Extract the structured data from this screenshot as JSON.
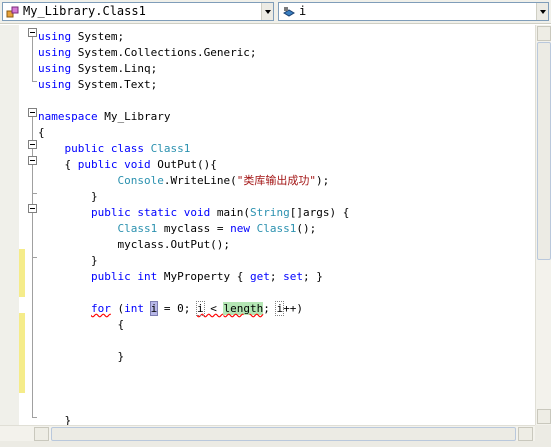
{
  "navbar": {
    "type_combo_value": "My_Library.Class1",
    "member_combo_value": "i"
  },
  "editor": {
    "lines": [
      {
        "parts": [
          {
            "t": "using",
            "c": "kw"
          },
          {
            "t": " System;"
          }
        ]
      },
      {
        "parts": [
          {
            "t": "using",
            "c": "kw"
          },
          {
            "t": " System.Collections.Generic;"
          }
        ]
      },
      {
        "parts": [
          {
            "t": "using",
            "c": "kw"
          },
          {
            "t": " System.Linq;"
          }
        ]
      },
      {
        "parts": [
          {
            "t": "using",
            "c": "kw"
          },
          {
            "t": " System.Text;"
          }
        ]
      },
      {
        "parts": []
      },
      {
        "parts": [
          {
            "t": "namespace",
            "c": "kw"
          },
          {
            "t": " My_Library"
          }
        ]
      },
      {
        "parts": [
          {
            "t": "{"
          }
        ]
      },
      {
        "parts": [
          {
            "t": "    "
          },
          {
            "t": "public",
            "c": "kw"
          },
          {
            "t": " "
          },
          {
            "t": "class",
            "c": "kw"
          },
          {
            "t": " "
          },
          {
            "t": "Class1",
            "c": "ty"
          }
        ]
      },
      {
        "parts": [
          {
            "t": "    { "
          },
          {
            "t": "public",
            "c": "kw"
          },
          {
            "t": " "
          },
          {
            "t": "void",
            "c": "kw"
          },
          {
            "t": " OutPut(){"
          }
        ]
      },
      {
        "parts": [
          {
            "t": "            "
          },
          {
            "t": "Console",
            "c": "ty"
          },
          {
            "t": ".WriteLine("
          },
          {
            "t": "\"类库输出成功\"",
            "c": "st"
          },
          {
            "t": ");"
          }
        ]
      },
      {
        "parts": [
          {
            "t": "        }"
          }
        ]
      },
      {
        "parts": [
          {
            "t": "        "
          },
          {
            "t": "public",
            "c": "kw"
          },
          {
            "t": " "
          },
          {
            "t": "static",
            "c": "kw"
          },
          {
            "t": " "
          },
          {
            "t": "void",
            "c": "kw"
          },
          {
            "t": " main("
          },
          {
            "t": "String",
            "c": "ty"
          },
          {
            "t": "[]args) {"
          }
        ]
      },
      {
        "parts": [
          {
            "t": "            "
          },
          {
            "t": "Class1",
            "c": "ty"
          },
          {
            "t": " myclass = "
          },
          {
            "t": "new",
            "c": "kw"
          },
          {
            "t": " "
          },
          {
            "t": "Class1",
            "c": "ty"
          },
          {
            "t": "();"
          }
        ]
      },
      {
        "parts": [
          {
            "t": "            myclass.OutPut();"
          }
        ]
      },
      {
        "parts": [
          {
            "t": "        }"
          }
        ]
      },
      {
        "parts": [
          {
            "t": "        "
          },
          {
            "t": "public",
            "c": "kw"
          },
          {
            "t": " "
          },
          {
            "t": "int",
            "c": "kw"
          },
          {
            "t": " MyProperty { "
          },
          {
            "t": "get",
            "c": "kw"
          },
          {
            "t": "; "
          },
          {
            "t": "set",
            "c": "kw"
          },
          {
            "t": "; }"
          }
        ]
      },
      {
        "parts": []
      },
      {
        "parts": [
          {
            "t": "        "
          },
          {
            "t": "for",
            "c": "kw err"
          },
          {
            "t": " ("
          },
          {
            "t": "int",
            "c": "kw"
          },
          {
            "t": " "
          },
          {
            "t": "i",
            "c": "sel"
          },
          {
            "t": " = 0; "
          },
          {
            "t": "i",
            "c": "ref err"
          },
          {
            "t": " < ",
            "c": "err"
          },
          {
            "t": "length",
            "c": "hl err"
          },
          {
            "t": "; "
          },
          {
            "t": "i",
            "c": "ref"
          },
          {
            "t": "++)"
          }
        ]
      },
      {
        "parts": [
          {
            "t": "            {"
          }
        ]
      },
      {
        "parts": []
      },
      {
        "parts": [
          {
            "t": "            }"
          }
        ]
      },
      {
        "parts": []
      },
      {
        "parts": []
      },
      {
        "parts": []
      },
      {
        "parts": [
          {
            "t": "    }"
          }
        ]
      },
      {
        "parts": [
          {
            "t": "}"
          }
        ]
      }
    ]
  }
}
